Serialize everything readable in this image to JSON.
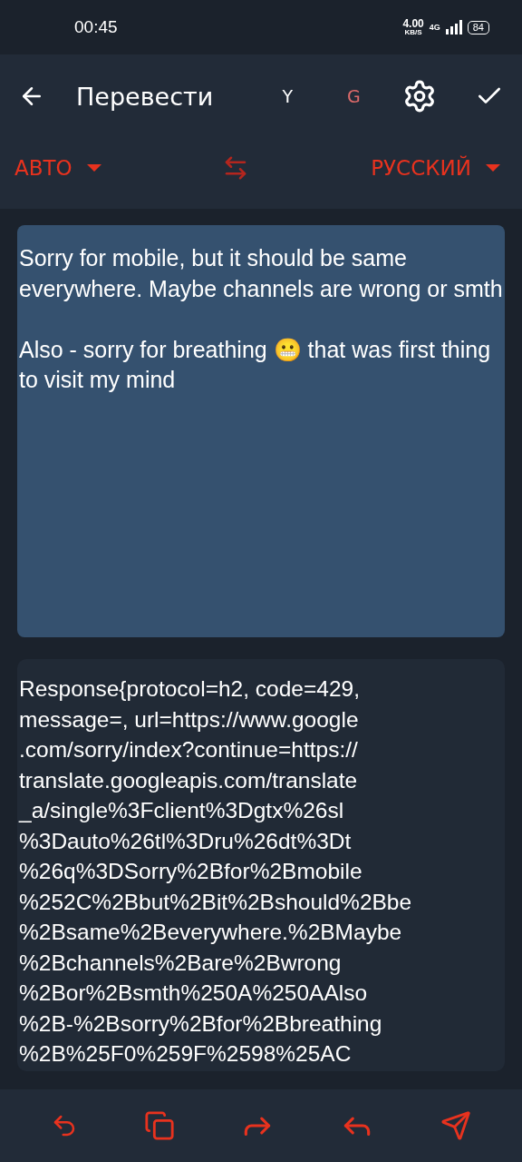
{
  "status_bar": {
    "time": "00:45",
    "speed": "4.00",
    "speed_unit": "KB/S",
    "network": "4G",
    "battery": "84"
  },
  "toolbar": {
    "title": "Перевести",
    "engines": [
      {
        "label": "Y",
        "selected": false
      },
      {
        "label": "G",
        "selected": true
      }
    ]
  },
  "languages": {
    "source": "АВТО",
    "target": "РУССКИЙ"
  },
  "source_text": "Sorry for mobile, but it should be same everywhere. Maybe channels are wrong or smth\n\nAlso - sorry for breathing 😬 that was first thing to visit my mind",
  "result_text": "Response{protocol=h2, code=429,\nmessage=, url=https://www.google\n.com/sorry/index?continue=https://\ntranslate.googleapis.com/translate\n_a/single%3Fclient%3Dgtx%26sl\n%3Dauto%26tl%3Dru%26dt%3Dt\n%26q%3DSorry%2Bfor%2Bmobile\n%252C%2Bbut%2Bit%2Bshould%2Bbe\n%2Bsame%2Beverywhere.%2BMaybe\n%2Bchannels%2Bare%2Bwrong\n%2Bor%2Bsmth%250A%250AAlso\n%2B-%2Bsorry%2Bfor%2Bbreathing\n%2B%25F0%259F%2598%25AC"
}
